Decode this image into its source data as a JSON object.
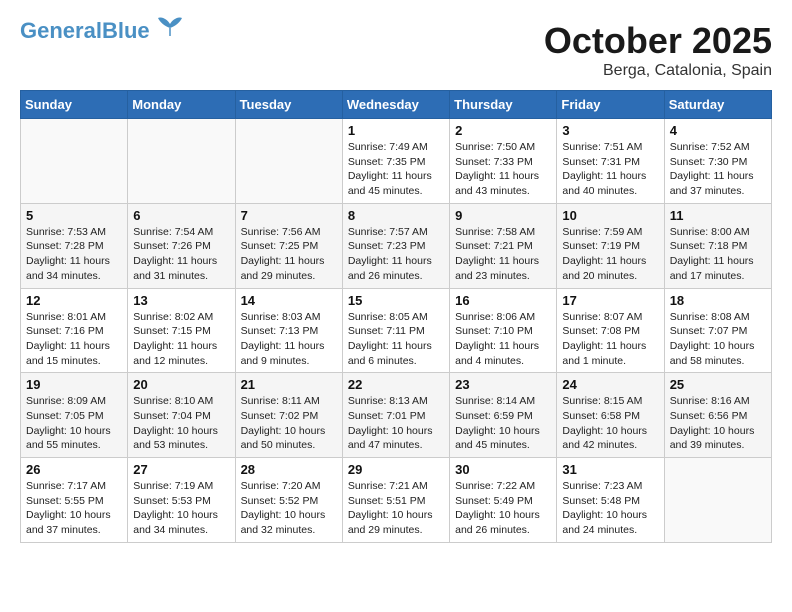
{
  "header": {
    "logo_general": "General",
    "logo_blue": "Blue",
    "month_title": "October 2025",
    "location": "Berga, Catalonia, Spain"
  },
  "weekdays": [
    "Sunday",
    "Monday",
    "Tuesday",
    "Wednesday",
    "Thursday",
    "Friday",
    "Saturday"
  ],
  "weeks": [
    [
      {
        "day": "",
        "info": ""
      },
      {
        "day": "",
        "info": ""
      },
      {
        "day": "",
        "info": ""
      },
      {
        "day": "1",
        "info": "Sunrise: 7:49 AM\nSunset: 7:35 PM\nDaylight: 11 hours and 45 minutes."
      },
      {
        "day": "2",
        "info": "Sunrise: 7:50 AM\nSunset: 7:33 PM\nDaylight: 11 hours and 43 minutes."
      },
      {
        "day": "3",
        "info": "Sunrise: 7:51 AM\nSunset: 7:31 PM\nDaylight: 11 hours and 40 minutes."
      },
      {
        "day": "4",
        "info": "Sunrise: 7:52 AM\nSunset: 7:30 PM\nDaylight: 11 hours and 37 minutes."
      }
    ],
    [
      {
        "day": "5",
        "info": "Sunrise: 7:53 AM\nSunset: 7:28 PM\nDaylight: 11 hours and 34 minutes."
      },
      {
        "day": "6",
        "info": "Sunrise: 7:54 AM\nSunset: 7:26 PM\nDaylight: 11 hours and 31 minutes."
      },
      {
        "day": "7",
        "info": "Sunrise: 7:56 AM\nSunset: 7:25 PM\nDaylight: 11 hours and 29 minutes."
      },
      {
        "day": "8",
        "info": "Sunrise: 7:57 AM\nSunset: 7:23 PM\nDaylight: 11 hours and 26 minutes."
      },
      {
        "day": "9",
        "info": "Sunrise: 7:58 AM\nSunset: 7:21 PM\nDaylight: 11 hours and 23 minutes."
      },
      {
        "day": "10",
        "info": "Sunrise: 7:59 AM\nSunset: 7:19 PM\nDaylight: 11 hours and 20 minutes."
      },
      {
        "day": "11",
        "info": "Sunrise: 8:00 AM\nSunset: 7:18 PM\nDaylight: 11 hours and 17 minutes."
      }
    ],
    [
      {
        "day": "12",
        "info": "Sunrise: 8:01 AM\nSunset: 7:16 PM\nDaylight: 11 hours and 15 minutes."
      },
      {
        "day": "13",
        "info": "Sunrise: 8:02 AM\nSunset: 7:15 PM\nDaylight: 11 hours and 12 minutes."
      },
      {
        "day": "14",
        "info": "Sunrise: 8:03 AM\nSunset: 7:13 PM\nDaylight: 11 hours and 9 minutes."
      },
      {
        "day": "15",
        "info": "Sunrise: 8:05 AM\nSunset: 7:11 PM\nDaylight: 11 hours and 6 minutes."
      },
      {
        "day": "16",
        "info": "Sunrise: 8:06 AM\nSunset: 7:10 PM\nDaylight: 11 hours and 4 minutes."
      },
      {
        "day": "17",
        "info": "Sunrise: 8:07 AM\nSunset: 7:08 PM\nDaylight: 11 hours and 1 minute."
      },
      {
        "day": "18",
        "info": "Sunrise: 8:08 AM\nSunset: 7:07 PM\nDaylight: 10 hours and 58 minutes."
      }
    ],
    [
      {
        "day": "19",
        "info": "Sunrise: 8:09 AM\nSunset: 7:05 PM\nDaylight: 10 hours and 55 minutes."
      },
      {
        "day": "20",
        "info": "Sunrise: 8:10 AM\nSunset: 7:04 PM\nDaylight: 10 hours and 53 minutes."
      },
      {
        "day": "21",
        "info": "Sunrise: 8:11 AM\nSunset: 7:02 PM\nDaylight: 10 hours and 50 minutes."
      },
      {
        "day": "22",
        "info": "Sunrise: 8:13 AM\nSunset: 7:01 PM\nDaylight: 10 hours and 47 minutes."
      },
      {
        "day": "23",
        "info": "Sunrise: 8:14 AM\nSunset: 6:59 PM\nDaylight: 10 hours and 45 minutes."
      },
      {
        "day": "24",
        "info": "Sunrise: 8:15 AM\nSunset: 6:58 PM\nDaylight: 10 hours and 42 minutes."
      },
      {
        "day": "25",
        "info": "Sunrise: 8:16 AM\nSunset: 6:56 PM\nDaylight: 10 hours and 39 minutes."
      }
    ],
    [
      {
        "day": "26",
        "info": "Sunrise: 7:17 AM\nSunset: 5:55 PM\nDaylight: 10 hours and 37 minutes."
      },
      {
        "day": "27",
        "info": "Sunrise: 7:19 AM\nSunset: 5:53 PM\nDaylight: 10 hours and 34 minutes."
      },
      {
        "day": "28",
        "info": "Sunrise: 7:20 AM\nSunset: 5:52 PM\nDaylight: 10 hours and 32 minutes."
      },
      {
        "day": "29",
        "info": "Sunrise: 7:21 AM\nSunset: 5:51 PM\nDaylight: 10 hours and 29 minutes."
      },
      {
        "day": "30",
        "info": "Sunrise: 7:22 AM\nSunset: 5:49 PM\nDaylight: 10 hours and 26 minutes."
      },
      {
        "day": "31",
        "info": "Sunrise: 7:23 AM\nSunset: 5:48 PM\nDaylight: 10 hours and 24 minutes."
      },
      {
        "day": "",
        "info": ""
      }
    ]
  ]
}
